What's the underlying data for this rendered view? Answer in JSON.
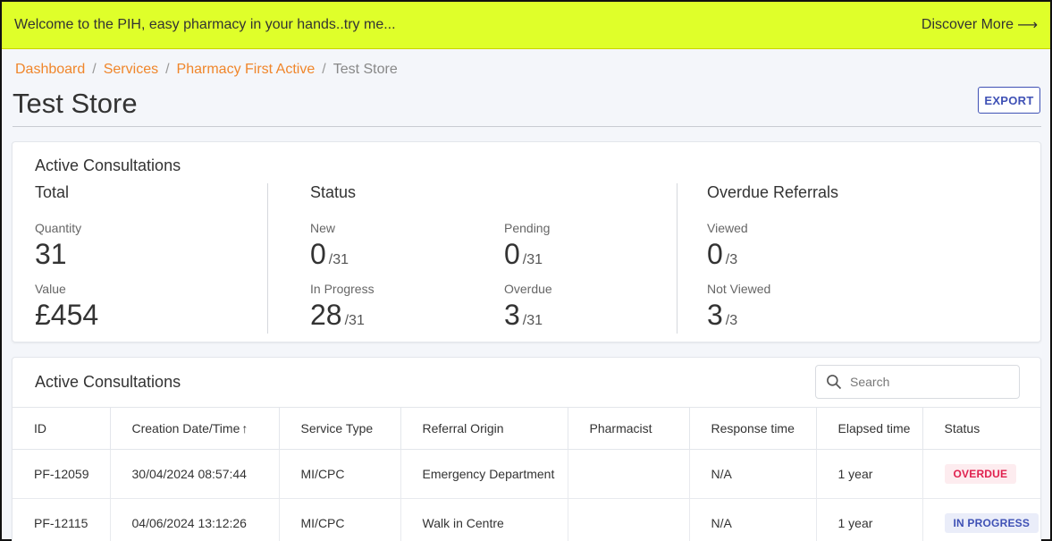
{
  "banner": {
    "message": "Welcome to the PIH, easy pharmacy in your hands..try me...",
    "discover_label": "Discover More",
    "discover_arrow": "⟶"
  },
  "breadcrumb": [
    {
      "label": "Dashboard"
    },
    {
      "label": "Services"
    },
    {
      "label": "Pharmacy First Active"
    },
    {
      "label": "Test Store"
    }
  ],
  "breadcrumb_sep": "/",
  "page": {
    "title": "Test Store",
    "export_label": "EXPORT"
  },
  "summary": {
    "title": "Active Consultations",
    "total": {
      "heading": "Total",
      "quantity_label": "Quantity",
      "quantity_value": "31",
      "value_label": "Value",
      "value_value": "£454"
    },
    "status": {
      "heading": "Status",
      "new_label": "New",
      "new_value": "0",
      "new_denom": "/31",
      "pending_label": "Pending",
      "pending_value": "0",
      "pending_denom": "/31",
      "in_progress_label": "In Progress",
      "in_progress_value": "28",
      "in_progress_denom": "/31",
      "overdue_label": "Overdue",
      "overdue_value": "3",
      "overdue_denom": "/31"
    },
    "overdue_referrals": {
      "heading": "Overdue Referrals",
      "viewed_label": "Viewed",
      "viewed_value": "0",
      "viewed_denom": "/3",
      "not_viewed_label": "Not Viewed",
      "not_viewed_value": "3",
      "not_viewed_denom": "/3"
    }
  },
  "table": {
    "title": "Active Consultations",
    "search_placeholder": "Search",
    "sort_arrow": "↑",
    "columns": [
      "ID",
      "Creation Date/Time",
      "Service Type",
      "Referral Origin",
      "Pharmacist",
      "Response time",
      "Elapsed time",
      "Status"
    ],
    "rows": [
      {
        "id": "PF-12059",
        "created": "30/04/2024 08:57:44",
        "service": "MI/CPC",
        "origin": "Emergency Department",
        "pharmacist": "",
        "response": "N/A",
        "elapsed": "1 year",
        "status": "OVERDUE"
      },
      {
        "id": "PF-12115",
        "created": "04/06/2024 13:12:26",
        "service": "MI/CPC",
        "origin": "Walk in Centre",
        "pharmacist": "",
        "response": "N/A",
        "elapsed": "1 year",
        "status": "IN PROGRESS"
      }
    ]
  },
  "colors": {
    "banner_bg": "#dfff2a",
    "link_orange": "#f0862b",
    "primary_indigo": "#3f51b5",
    "overdue_red": "#e0224f"
  }
}
